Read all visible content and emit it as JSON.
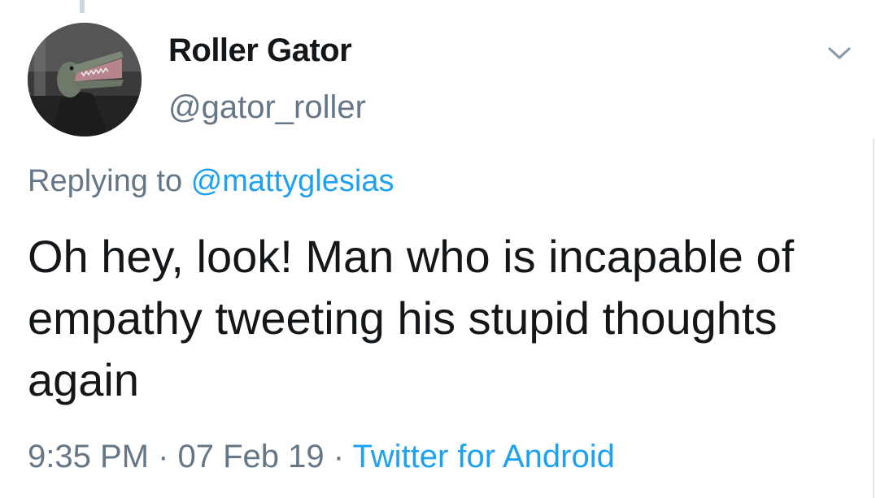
{
  "tweet": {
    "display_name": "Roller Gator",
    "handle": "@gator_roller",
    "reply_prefix": "Replying to",
    "reply_to": "@mattyglesias",
    "text": "Oh hey, look! Man who is incapable of empathy tweeting his stupid thoughts again",
    "time": "9:35 PM",
    "separator": " · ",
    "date": "07 Feb 19",
    "source": "Twitter for Android"
  },
  "icons": {
    "avatar": "alligator-avatar",
    "menu": "chevron-down-icon"
  },
  "colors": {
    "link": "#1da1f2",
    "secondary": "#657786",
    "primary_text": "#14171a"
  }
}
